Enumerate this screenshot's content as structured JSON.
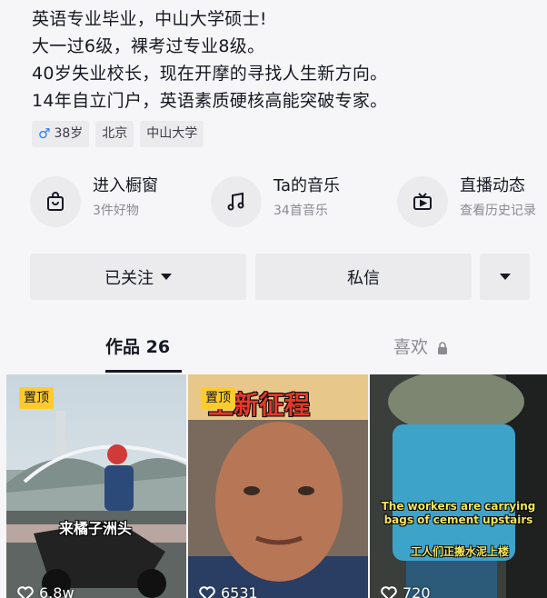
{
  "bio": {
    "lines": [
      "英语专业毕业，中山大学硕士!",
      "大一过6级，裸考过专业8级。",
      "40岁失业校长，现在开摩的寻找人生新方向。",
      "14年自立门户，英语素质硬核高能突破专家。"
    ]
  },
  "tags": {
    "gender_age": "38岁",
    "location": "北京",
    "school": "中山大学"
  },
  "quick_links": [
    {
      "title": "进入橱窗",
      "subtitle": "3件好物",
      "icon": "shopping-bag-icon"
    },
    {
      "title": "Ta的音乐",
      "subtitle": "34首音乐",
      "icon": "music-note-icon"
    },
    {
      "title": "直播动态",
      "subtitle": "查看历史记录",
      "icon": "live-tv-icon"
    }
  ],
  "actions": {
    "follow_label": "已关注",
    "message_label": "私信"
  },
  "tabs": {
    "works": "作品 26",
    "likes": "喜欢"
  },
  "videos": [
    {
      "pinned": "置顶",
      "likes": "6.8w",
      "caption": "来橘子洲头"
    },
    {
      "pinned": "置顶",
      "likes": "6531",
      "caption": "上新征程"
    },
    {
      "likes": "720",
      "caption_en": "The workers are carrying bags of cement upstairs",
      "caption_zh": "工人们正搬水泥上楼"
    }
  ],
  "colors": {
    "accent_yellow": "#fecb2d",
    "male_blue": "#2b7cf7",
    "background": "#f6f6f8"
  }
}
